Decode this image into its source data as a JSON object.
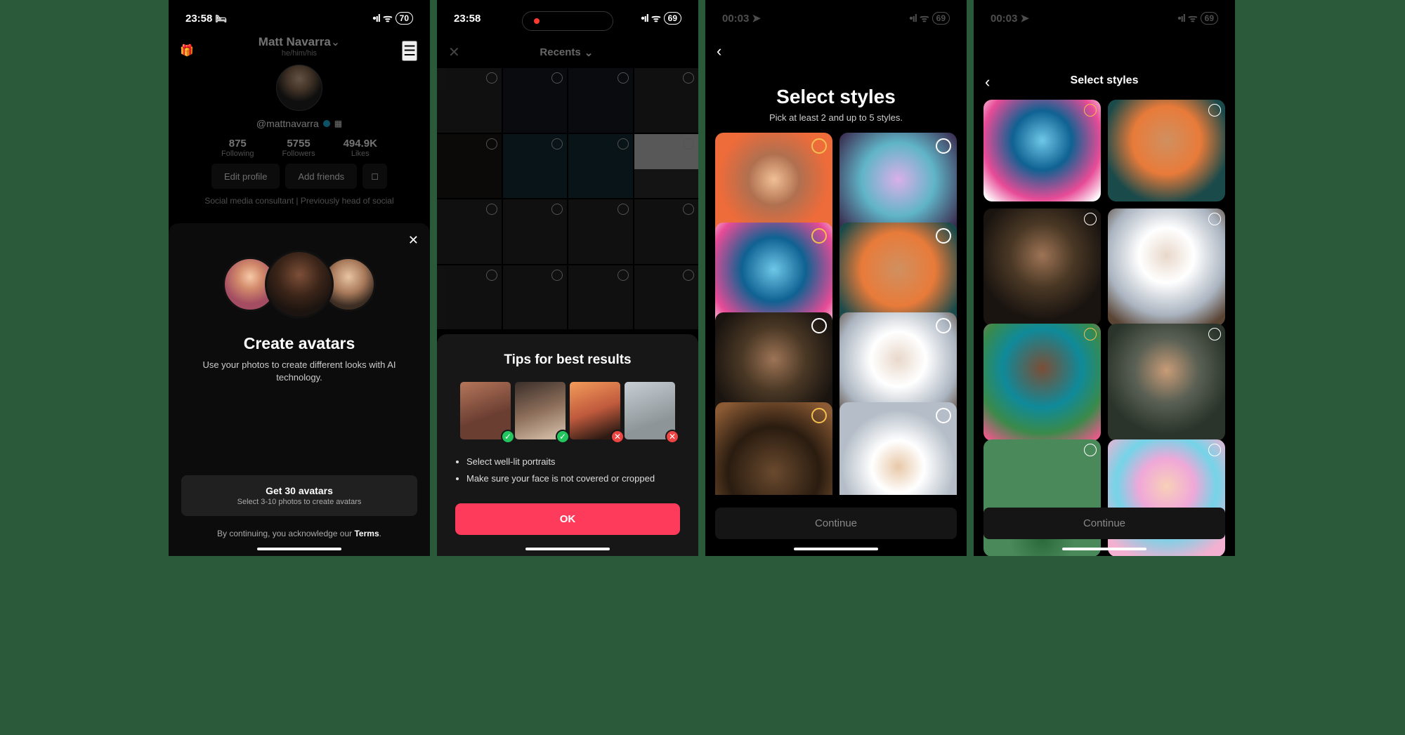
{
  "screen1": {
    "status": {
      "time": "23:58",
      "battery": "70"
    },
    "profile": {
      "name": "Matt Navarra",
      "name_chevron": "⌄",
      "pronouns": "he/him/his",
      "handle": "@mattnavarra",
      "following_count": "875",
      "following_label": "Following",
      "followers_count": "5755",
      "followers_label": "Followers",
      "likes_count": "494.9K",
      "likes_label": "Likes",
      "edit_profile": "Edit profile",
      "add_friends": "Add friends",
      "bio": "Social media consultant | Previously head of social"
    },
    "sheet": {
      "title": "Create avatars",
      "subtitle": "Use your photos to create different looks with AI technology.",
      "get_title": "Get 30 avatars",
      "get_sub": "Select 3-10 photos to create avatars",
      "ack_prefix": "By continuing, you acknowledge our ",
      "ack_terms": "Terms",
      "ack_suffix": "."
    }
  },
  "screen2": {
    "status": {
      "time": "23:58",
      "battery": "69"
    },
    "picker_title": "Recents",
    "tips": {
      "title": "Tips for best results",
      "bullets": [
        "Select well-lit portraits",
        "Make sure your face is not covered or cropped"
      ],
      "ok": "OK"
    }
  },
  "screen3": {
    "status": {
      "time": "00:03",
      "battery": "69"
    },
    "title": "Select styles",
    "subtitle": "Pick at least 2 and up to 5 styles.",
    "continue": "Continue"
  },
  "screen4": {
    "status": {
      "time": "00:03",
      "battery": "69"
    },
    "title": "Select styles",
    "continue": "Continue"
  }
}
